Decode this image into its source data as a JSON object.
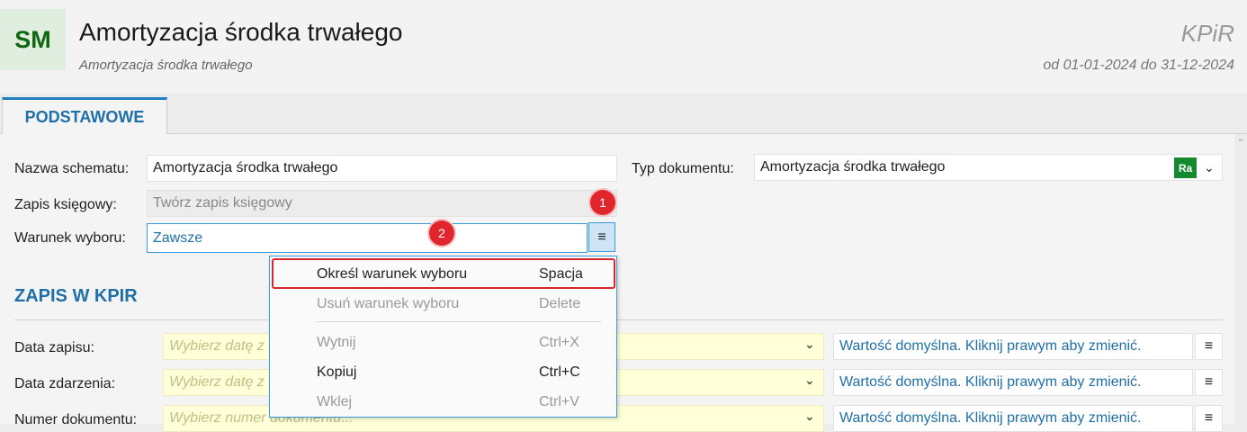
{
  "header": {
    "logo": "SM",
    "title": "Amortyzacja środka trwałego",
    "subtitle": "Amortyzacja środka trwałego",
    "app_name": "KPiR",
    "period": "od 01-01-2024 do 31-12-2024"
  },
  "tabs": [
    {
      "label": "PODSTAWOWE",
      "active": true
    }
  ],
  "form": {
    "name_label": "Nazwa schematu:",
    "name_value": "Amortyzacja środka trwałego",
    "doc_type_label": "Typ dokumentu:",
    "doc_type_value": "Amortyzacja środka trwałego",
    "doc_type_icon": "Ra",
    "entry_label": "Zapis księgowy:",
    "entry_value": "Twórz zapis księgowy",
    "condition_label": "Warunek wyboru:",
    "condition_value": "Zawsze",
    "condition_menu_icon": "≡"
  },
  "badges": [
    "1",
    "2"
  ],
  "section": {
    "title": "ZAPIS W KPIR",
    "rows": [
      {
        "label": "Data zapisu:",
        "placeholder": "Wybierz datę z",
        "hint": "Wartość domyślna. Kliknij prawym aby zmienić."
      },
      {
        "label": "Data zdarzenia:",
        "placeholder": "Wybierz datę z",
        "hint": "Wartość domyślna. Kliknij prawym aby zmienić."
      },
      {
        "label": "Numer dokumentu:",
        "placeholder": "Wybierz numer dokumentu...",
        "hint": "Wartość domyślna. Kliknij prawym aby zmienić."
      }
    ]
  },
  "context_menu": {
    "items": [
      {
        "label": "Określ warunek wyboru",
        "shortcut": "Spacja",
        "enabled": true,
        "highlighted": true
      },
      {
        "label": "Usuń warunek wyboru",
        "shortcut": "Delete",
        "enabled": false
      },
      {
        "label": "Wytnij",
        "shortcut": "Ctrl+X",
        "enabled": false
      },
      {
        "label": "Kopiuj",
        "shortcut": "Ctrl+C",
        "enabled": true
      },
      {
        "label": "Wklej",
        "shortcut": "Ctrl+V",
        "enabled": false
      }
    ]
  },
  "colors": {
    "accent": "#1f6fa8",
    "badge": "#e0262c",
    "highlight_border": "#d9262c",
    "logo_green": "#116611"
  }
}
